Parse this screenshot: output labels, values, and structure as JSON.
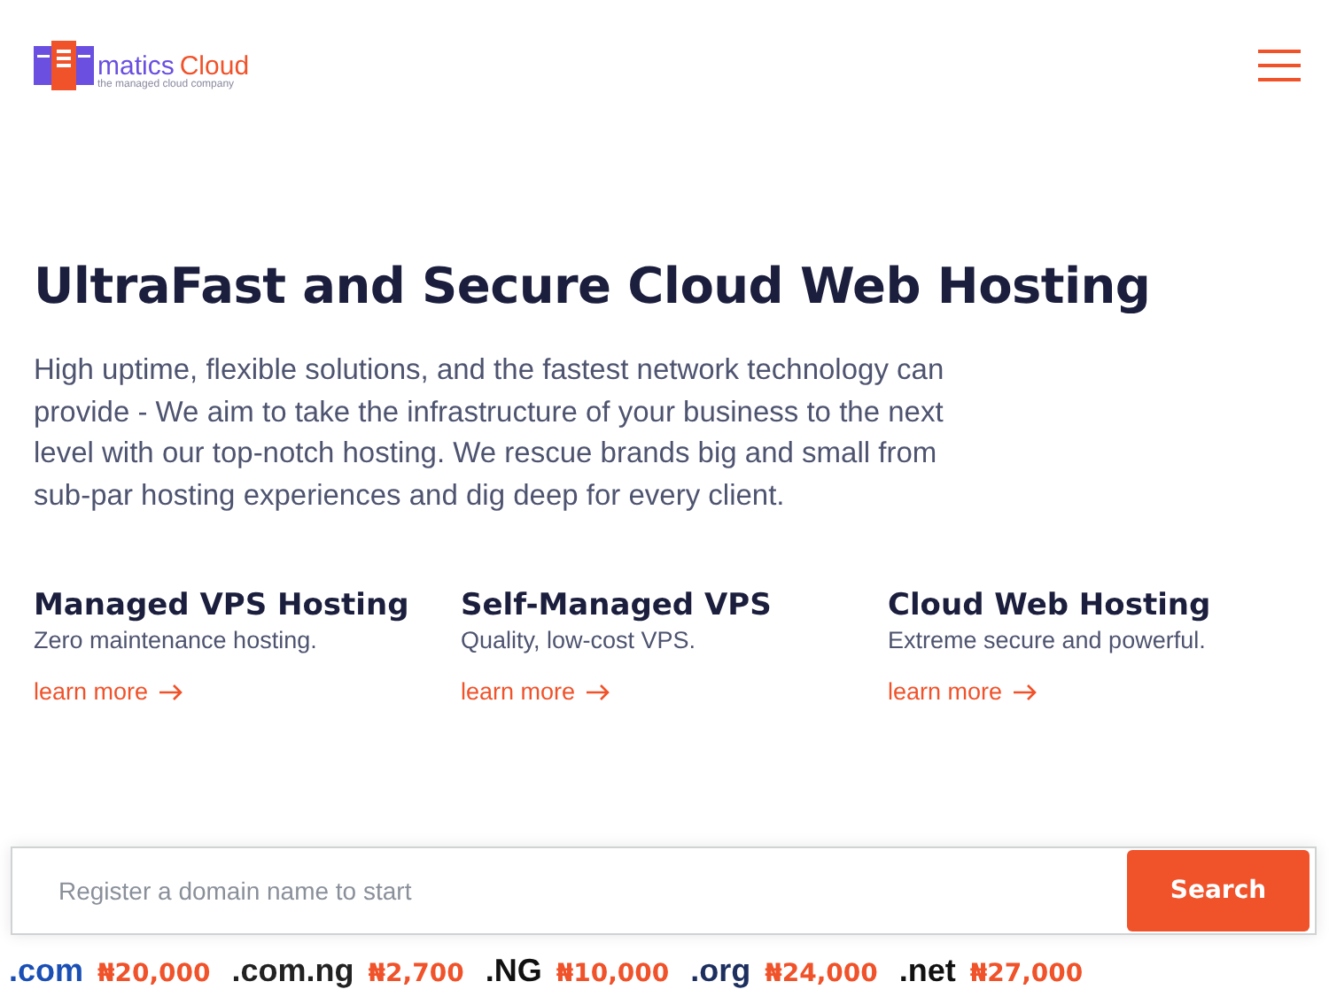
{
  "logo": {
    "word_1": "matics",
    "word_2": "Cloud",
    "tagline": "the managed cloud company"
  },
  "hero": {
    "title": "UltraFast and Secure Cloud Web Hosting",
    "description": "High uptime, flexible solutions, and the fastest network technology can provide - We aim to take the infrastructure of your business to the next level with our top-notch hosting. We rescue brands big and small from sub-par hosting experiences and dig deep for every client."
  },
  "services": [
    {
      "title": "Managed VPS Hosting",
      "subtitle": "Zero maintenance hosting.",
      "link": "learn more"
    },
    {
      "title": "Self-Managed VPS",
      "subtitle": "Quality, low-cost VPS.",
      "link": "learn more"
    },
    {
      "title": "Cloud Web Hosting",
      "subtitle": "Extreme secure and powerful.",
      "link": "learn more"
    }
  ],
  "search": {
    "placeholder": "Register a domain name to start",
    "button": "Search"
  },
  "domains": [
    {
      "name": ".com",
      "price": "₦20,000",
      "color": "#1a4fb5"
    },
    {
      "name": ".com.ng",
      "price": "₦2,700",
      "color": "#222222"
    },
    {
      "name": ".NG",
      "price": "₦10,000",
      "color": "#111111"
    },
    {
      "name": ".org",
      "price": "₦24,000",
      "color": "#1c2f5e"
    },
    {
      "name": ".net",
      "price": "₦27,000",
      "color": "#111111"
    }
  ]
}
